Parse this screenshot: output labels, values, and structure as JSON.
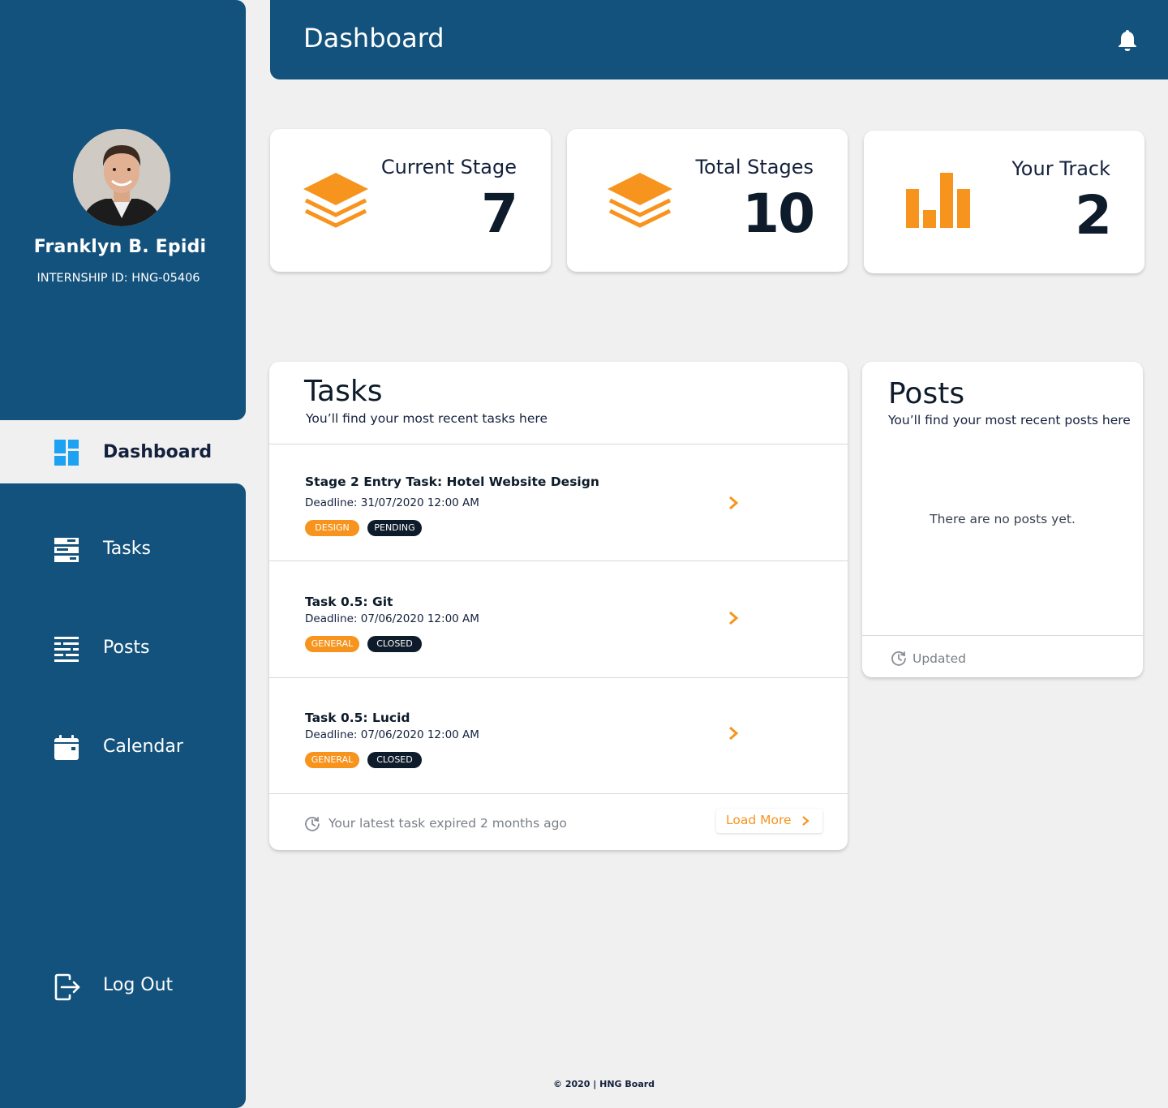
{
  "user": {
    "name": "Franklyn B. Epidi",
    "internship_id": "INTERNSHIP ID: HNG-05406"
  },
  "sidebar": {
    "items": [
      {
        "label": "Dashboard",
        "icon": "dashboard-icon",
        "active": true
      },
      {
        "label": "Tasks",
        "icon": "tasks-icon"
      },
      {
        "label": "Posts",
        "icon": "posts-icon"
      },
      {
        "label": "Calendar",
        "icon": "calendar-icon"
      },
      {
        "label": "Log Out",
        "icon": "logout-icon"
      }
    ]
  },
  "header": {
    "title": "Dashboard",
    "icon": "bell-icon"
  },
  "stats": [
    {
      "label": "Current Stage",
      "value": "7",
      "icon": "layers-icon"
    },
    {
      "label": "Total Stages",
      "value": "10",
      "icon": "layers-icon"
    },
    {
      "label": "Your Track",
      "value": "2",
      "icon": "bar-chart-icon"
    }
  ],
  "tasks": {
    "title": "Tasks",
    "subtitle": "You’ll find your most recent tasks here",
    "items": [
      {
        "title": "Stage 2 Entry Task: Hotel Website Design",
        "deadline": "Deadline: 31/07/2020 12:00 AM",
        "category": "DESIGN",
        "status": "PENDING"
      },
      {
        "title": "Task 0.5: Git",
        "deadline": "Deadline: 07/06/2020 12:00 AM",
        "category": "GENERAL",
        "status": "CLOSED"
      },
      {
        "title": "Task 0.5: Lucid",
        "deadline": "Deadline: 07/06/2020 12:00 AM",
        "category": "GENERAL",
        "status": "CLOSED"
      }
    ],
    "footer_text": "Your latest task expired 2 months ago",
    "load_more": "Load More"
  },
  "posts": {
    "title": "Posts",
    "subtitle": "You’ll find your most recent posts here",
    "empty_message": "There are no posts yet.",
    "updated": "Updated"
  },
  "footer": {
    "copyright": "© 2020 | HNG Board"
  },
  "colors": {
    "primary": "#13527c",
    "accent": "#f7941d",
    "dark": "#0d1b2a",
    "background": "#f0f0f0",
    "active_icon": "#1da1f2"
  }
}
